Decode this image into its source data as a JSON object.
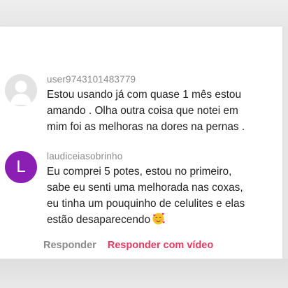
{
  "comments": [
    {
      "username": "user9743101483779",
      "avatar_icon": "default-user-avatar-icon",
      "text": "Estou usando já com quase 1 mês estou\namando . Olha outra coisa que notei em\nmim foi as melhoras na dores na pernas ."
    },
    {
      "username": "laudiceiasobrinho",
      "avatar_letter": "L",
      "avatar_color": "#8b1fb3",
      "text": "Eu comprei 5 potes, estou no primeiro,\nsabe eu senti uma melhorada nas coxas,\neu tinha um pouquinho de celulites e elas\nestão desaparecendo",
      "emoji_icon": "smiling-face-with-hearts-icon"
    }
  ],
  "actions": {
    "reply_label": "Responder",
    "reply_video_label": "Responder com vídeo",
    "reply_video_color": "#e8395f"
  }
}
